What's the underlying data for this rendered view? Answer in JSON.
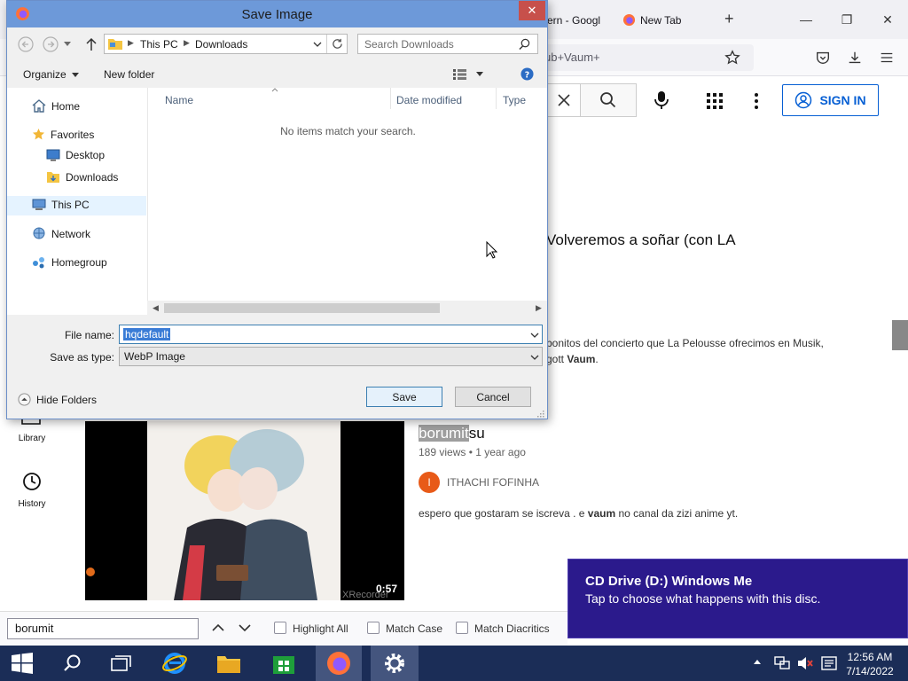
{
  "browser": {
    "tabs": [
      {
        "label": "ern - Googl"
      },
      {
        "label": "New Tab"
      }
    ],
    "new_tab_symbol": "+",
    "url_fragment": "ub+Vaum+",
    "window_controls": {
      "minimize": "—",
      "restore": "❐",
      "close": "✕"
    }
  },
  "youtube": {
    "sign_in_label": "SIGN IN",
    "result1": {
      "title": "Volveremos a soñar (con LA",
      "desc_line1": "bonitos del concierto que La Pelousse ofrecimos en Musik,",
      "desc_line2_prefix": "gott ",
      "desc_line2_bold": "Vaum",
      "desc_line2_suffix": "."
    },
    "guide": [
      {
        "label": "Library"
      },
      {
        "label": "History"
      }
    ],
    "video": {
      "duration": "0:57",
      "watermark": "XRecorder",
      "title_highlight": "borumit",
      "title_rest": "su",
      "views_age": "189 views • 1 year ago",
      "channel_initial": "I",
      "channel": "ITHACHI FOFINHA",
      "desc_prefix": "espero que gostaram se iscreva . e ",
      "desc_bold": "vaum",
      "desc_suffix": " no canal da zizi anime yt."
    }
  },
  "findbar": {
    "query": "borumit",
    "options": [
      {
        "label": "Highlight All"
      },
      {
        "label": "Match Case"
      },
      {
        "label": "Match Diacritics"
      }
    ]
  },
  "toast": {
    "title": "CD Drive (D:) Windows Me",
    "body": "Tap to choose what happens with this disc."
  },
  "taskbar": {
    "time": "12:56 AM",
    "date": "7/14/2022"
  },
  "dialog": {
    "title": "Save Image",
    "close": "✕",
    "breadcrumb": [
      "This PC",
      "Downloads"
    ],
    "search_placeholder": "Search Downloads",
    "organize_label": "Organize",
    "new_folder_label": "New folder",
    "nav": {
      "home": "Home",
      "favorites": "Favorites",
      "desktop": "Desktop",
      "downloads": "Downloads",
      "this_pc": "This PC",
      "network": "Network",
      "homegroup": "Homegroup"
    },
    "columns": {
      "name": "Name",
      "date_modified": "Date modified",
      "type": "Type"
    },
    "empty_message": "No items match your search.",
    "file_name_label": "File name:",
    "file_name_value": "hqdefault",
    "save_type_label": "Save as type:",
    "save_type_value": "WebP Image",
    "hide_folders_label": "Hide Folders",
    "save_button": "Save",
    "cancel_button": "Cancel"
  },
  "colors": {
    "dialog_titlebar": "#6d99d9",
    "close_button": "#c7504b",
    "youtube_blue": "#065fd4",
    "toast_bg": "#2b1a8c",
    "taskbar_bg": "#1b2d57"
  }
}
